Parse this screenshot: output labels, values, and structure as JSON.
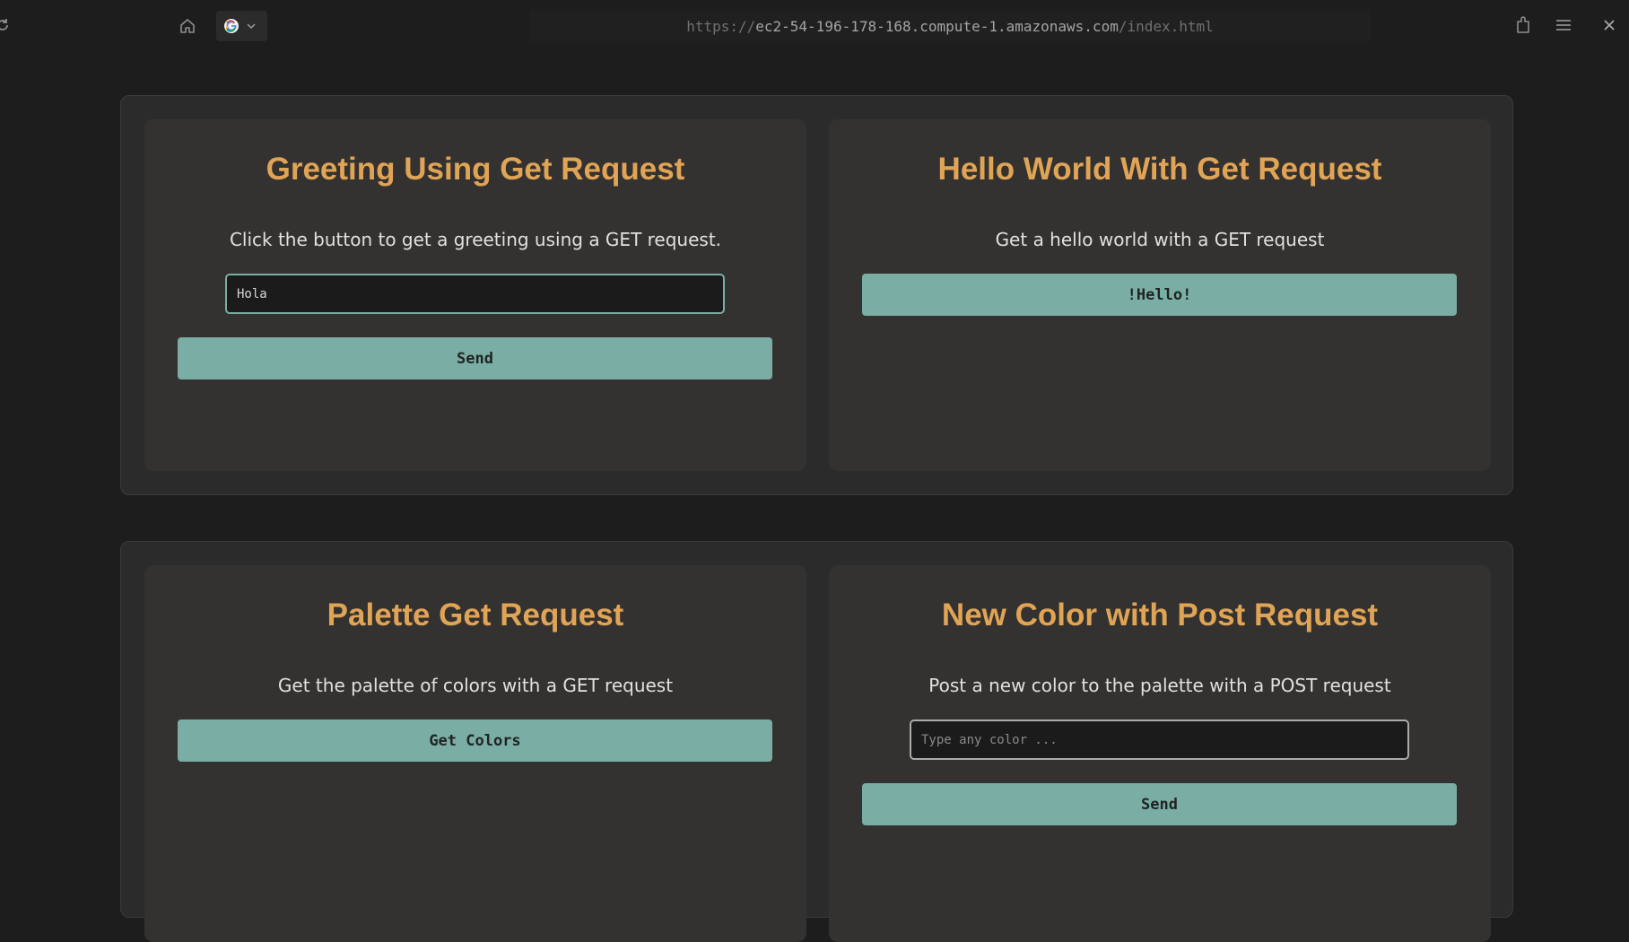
{
  "browser": {
    "url_scheme": "https://",
    "url_host": "ec2-54-196-178-168.compute-1.amazonaws.com",
    "url_path": "/index.html",
    "search_engine_icon": "google-icon",
    "icons": [
      "reload-icon",
      "home-icon",
      "chevron-down-icon",
      "extensions-icon",
      "menu-icon",
      "close-icon"
    ]
  },
  "cards": {
    "greeting": {
      "title": "Greeting Using Get Request",
      "description": "Click the button to get a greeting using a GET request.",
      "input_value": "Hola",
      "button_label": "Send"
    },
    "hello": {
      "title": "Hello World With Get Request",
      "description": "Get a hello world with a GET request",
      "button_label": "!Hello!"
    },
    "palette": {
      "title": "Palette Get Request",
      "description": "Get the palette of colors with a GET request",
      "button_label": "Get Colors"
    },
    "new_color": {
      "title": "New Color with Post Request",
      "description": "Post a new color to the palette with a POST request",
      "input_placeholder": "Type any color ...",
      "button_label": "Send"
    }
  },
  "colors": {
    "accent": "#7aaea4",
    "title": "#e0a456",
    "background": "#1d1d1d",
    "card": "#343230"
  }
}
